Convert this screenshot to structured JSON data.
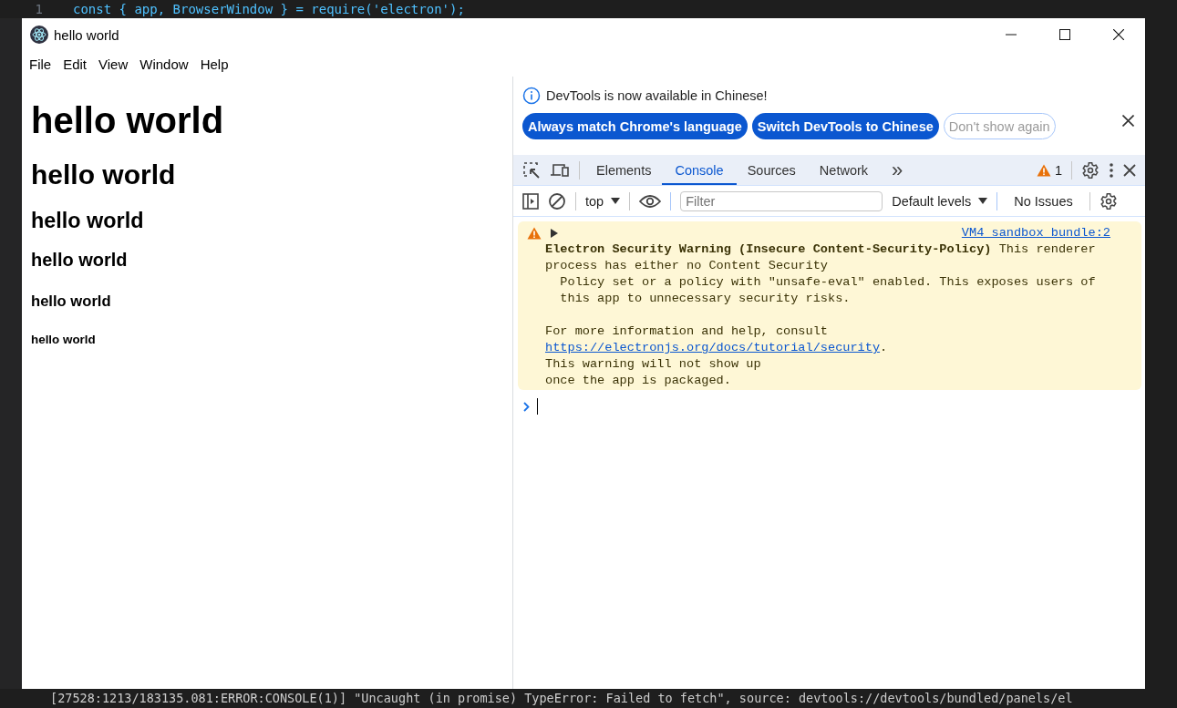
{
  "editor": {
    "line_number": "1",
    "code_line": "const { app, BrowserWindow } = require('electron');"
  },
  "window": {
    "title": "hello world",
    "menu": [
      "File",
      "Edit",
      "View",
      "Window",
      "Help"
    ]
  },
  "page": {
    "headings": [
      "hello world",
      "hello world",
      "hello world",
      "hello world",
      "hello world",
      "hello world"
    ]
  },
  "devtools": {
    "infobar": {
      "message": "DevTools is now available in Chinese!",
      "buttons": [
        {
          "label": "Always match Chrome's language",
          "kind": "primary"
        },
        {
          "label": "Switch DevTools to Chinese",
          "kind": "primary"
        },
        {
          "label": "Don't show again",
          "kind": "outline"
        }
      ]
    },
    "tabs": [
      {
        "label": "Elements",
        "selected": false
      },
      {
        "label": "Console",
        "selected": true
      },
      {
        "label": "Sources",
        "selected": false
      },
      {
        "label": "Network",
        "selected": false
      }
    ],
    "more_tabs": "»",
    "warning_count": "1",
    "context": "top",
    "filter": {
      "placeholder": "Filter"
    },
    "levels": "Default levels",
    "issues": "No Issues",
    "messages": [
      {
        "kind": "warning",
        "expanded": false,
        "source": "VM4 sandbox_bundle:2",
        "text": "**Electron Security Warning (Insecure Content-Security-Policy)** This renderer\nprocess has either no Content Security\n  Policy set or a policy with \"unsafe-eval\" enabled. This exposes users of\n  this app to unnecessary security risks.",
        "help_before": "For more information and help, consult",
        "help_link": "https://electronjs.org/docs/tutorial/security",
        "help_after": ".\nThis warning will not show up\nonce the app is packaged."
      }
    ]
  },
  "terminal": {
    "line": "[27528:1213/183135.081:ERROR:CONSOLE(1)] \"Uncaught (in promise) TypeError: Failed to fetch\", source: devtools://devtools/bundled/panels/el"
  }
}
